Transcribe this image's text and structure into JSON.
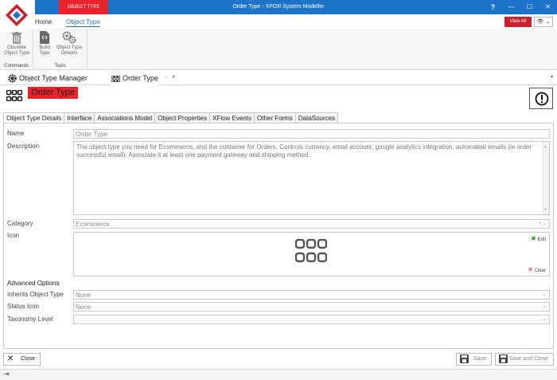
{
  "window": {
    "title": "Order Type - XPOR System Modeller",
    "context_tab": "OBJECT TYPE",
    "controls": {
      "help": "?",
      "minimize": "—",
      "maximize": "☐",
      "close": "✕"
    },
    "accent": "#1e73c8"
  },
  "ribbon": {
    "tabs": [
      {
        "label": "Home"
      },
      {
        "label": "Object Type"
      }
    ],
    "view_all": "View All",
    "eye_btn": "👁 ⌄",
    "groups": {
      "commands": {
        "label": "Commands",
        "buttons": [
          {
            "label": "Obsolete Object Type",
            "icon": "trash-icon"
          }
        ]
      },
      "tools": {
        "label": "Tools",
        "buttons": [
          {
            "label": "Build Type",
            "icon": "build-icon"
          },
          {
            "label": "Object Type Options",
            "icon": "gears-icon"
          }
        ]
      }
    }
  },
  "doc_tabs": [
    {
      "label": "Object Type Manager",
      "icon": "gear-icon"
    },
    {
      "label": "Order Type",
      "icon": "grid-icon",
      "active": true
    }
  ],
  "header": {
    "title": "Order Type",
    "title_color": "#e8232b"
  },
  "form_tabs": [
    {
      "label": "Object Type Details",
      "active": true
    },
    {
      "label": "Interface"
    },
    {
      "label": "Associations Model"
    },
    {
      "label": "Object Properties"
    },
    {
      "label": "XFlow Events"
    },
    {
      "label": "Other Forms"
    },
    {
      "label": "DataSources"
    }
  ],
  "form": {
    "name": {
      "label": "Name",
      "value": "Order Type"
    },
    "description": {
      "label": "Description",
      "value": "The object type you need for Ecommerce, and the container for Orders. Controls currency, email account, google analytics integration, automated emails (ie order successful email). Associate it at least one payment gateway and shipping method."
    },
    "category": {
      "label": "Category",
      "value": "Ecommerce"
    },
    "icon": {
      "label": "Icon",
      "edit": "Edit",
      "clear": "Clear"
    },
    "advanced_title": "Advanced Options",
    "inherits": {
      "label": "Inherits Object Type",
      "value": "None"
    },
    "status_icon": {
      "label": "Status Icon",
      "value": "None"
    },
    "taxonomy": {
      "label": "Taxonomy Level",
      "value": ""
    }
  },
  "footer": {
    "close": "Close",
    "save": "Save",
    "save_close": "Save and Close"
  }
}
